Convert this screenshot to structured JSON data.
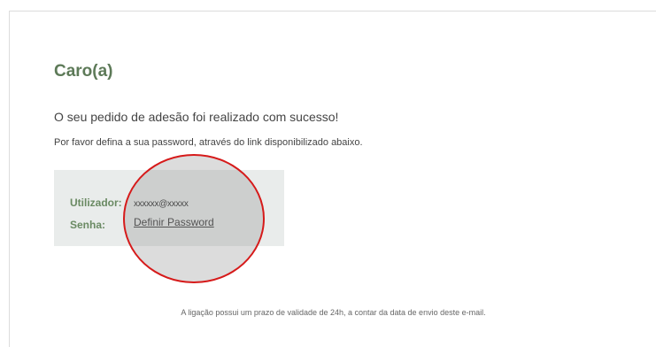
{
  "email": {
    "greeting": "Caro(a)",
    "success_message": "O seu pedido de adesão foi realizado com sucesso!",
    "instructions": "Por favor defina a sua password, através do link disponibilizado abaixo.",
    "credentials": {
      "user_label": "Utilizador:",
      "user_value": "xxxxxx@xxxxx",
      "password_label": "Senha:",
      "password_link": "Definir Password"
    },
    "validity_note": "A ligação possui um prazo de validade de 24h, a contar da data de envio deste e-mail."
  },
  "colors": {
    "accent_green": "#5d7a58",
    "box_background": "#e9eceb",
    "highlight_red": "#d61a1a"
  }
}
